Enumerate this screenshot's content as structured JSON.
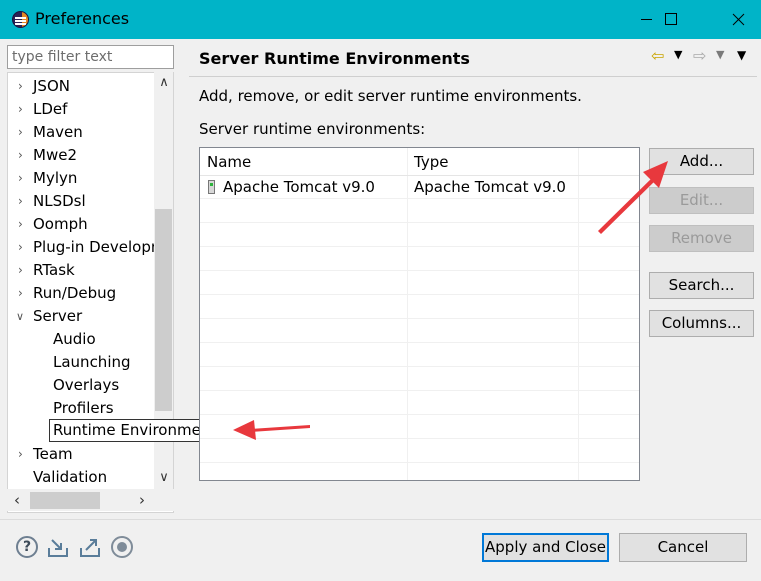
{
  "window": {
    "title": "Preferences",
    "icon": "eclipse-icon"
  },
  "sidebar": {
    "filter_placeholder": "type filter text",
    "items": [
      {
        "label": "JSON",
        "expanded": false
      },
      {
        "label": "LDef",
        "expanded": false
      },
      {
        "label": "Maven",
        "expanded": false
      },
      {
        "label": "Mwe2",
        "expanded": false
      },
      {
        "label": "Mylyn",
        "expanded": false
      },
      {
        "label": "NLSDsl",
        "expanded": false
      },
      {
        "label": "Oomph",
        "expanded": false
      },
      {
        "label": "Plug-in Developr",
        "expanded": false
      },
      {
        "label": "RTask",
        "expanded": false
      },
      {
        "label": "Run/Debug",
        "expanded": false
      },
      {
        "label": "Server",
        "expanded": true
      },
      {
        "label": "Audio",
        "child": true
      },
      {
        "label": "Launching",
        "child": true
      },
      {
        "label": "Overlays",
        "child": true
      },
      {
        "label": "Profilers",
        "child": true
      },
      {
        "label": "Runtime Environments",
        "child": true,
        "selected": true
      },
      {
        "label": "Team",
        "expanded": false
      },
      {
        "label": "Validation",
        "leaf": true
      }
    ]
  },
  "main": {
    "title": "Server Runtime Environments",
    "description": "Add, remove, or edit server runtime environments.",
    "list_label": "Server runtime environments:",
    "table": {
      "columns": [
        "Name",
        "Type"
      ],
      "rows": [
        {
          "name": "Apache Tomcat v9.0",
          "type": "Apache Tomcat v9.0",
          "checked": true
        }
      ]
    },
    "buttons": {
      "add": "Add...",
      "edit": "Edit...",
      "remove": "Remove",
      "search": "Search...",
      "columns": "Columns..."
    }
  },
  "footer": {
    "apply_close": "Apply and Close",
    "cancel": "Cancel"
  },
  "colors": {
    "titlebar": "#00b4c8",
    "annotation_arrow": "#e8383d",
    "focus_border": "#0078d7"
  }
}
